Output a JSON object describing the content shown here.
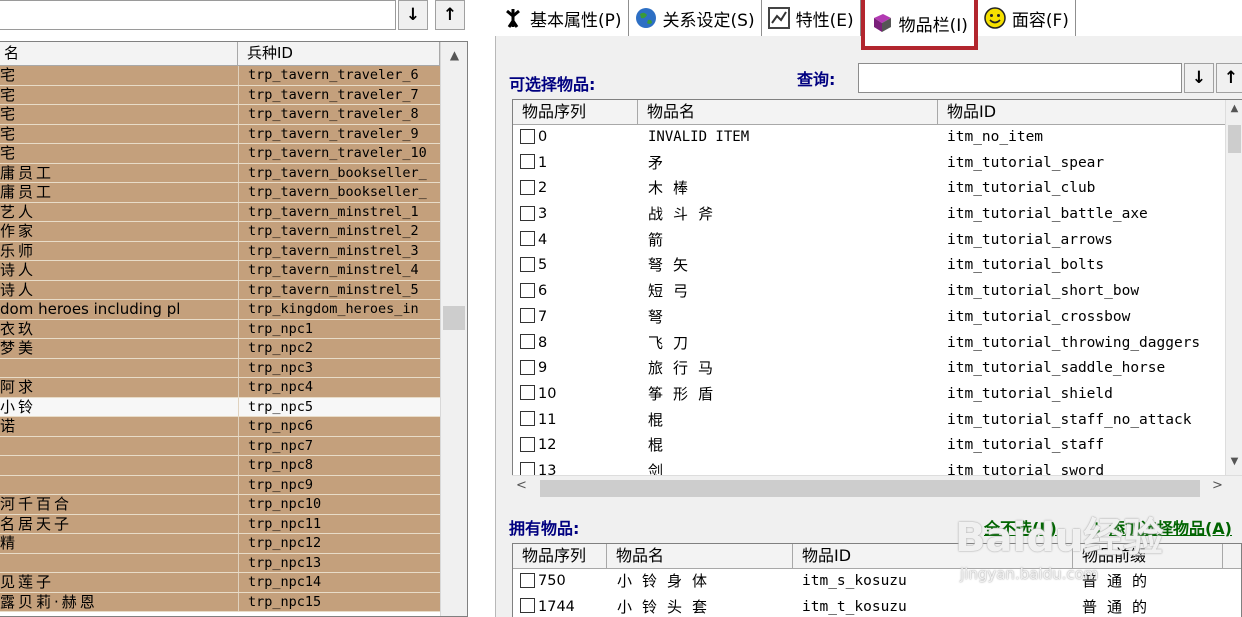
{
  "left_panel": {
    "sort_down_label": "↓",
    "sort_up_label": "↑",
    "columns": [
      "名",
      "兵种ID"
    ],
    "rows": [
      {
        "name": "宅",
        "id": "trp_tavern_traveler_6"
      },
      {
        "name": "宅",
        "id": "trp_tavern_traveler_7"
      },
      {
        "name": "宅",
        "id": "trp_tavern_traveler_8"
      },
      {
        "name": "宅",
        "id": "trp_tavern_traveler_9"
      },
      {
        "name": "宅",
        "id": "trp_tavern_traveler_10"
      },
      {
        "name": "庸员工",
        "id": "trp_tavern_bookseller_"
      },
      {
        "name": "庸员工",
        "id": "trp_tavern_bookseller_"
      },
      {
        "name": "艺人",
        "id": "trp_tavern_minstrel_1"
      },
      {
        "name": "作家",
        "id": "trp_tavern_minstrel_2"
      },
      {
        "name": "乐师",
        "id": "trp_tavern_minstrel_3"
      },
      {
        "name": "诗人",
        "id": "trp_tavern_minstrel_4"
      },
      {
        "name": "诗人",
        "id": "trp_tavern_minstrel_5"
      },
      {
        "name": "dom heroes including pl",
        "id": "trp_kingdom_heroes_in"
      },
      {
        "name": "衣玖",
        "id": "trp_npc1"
      },
      {
        "name": "梦美",
        "id": "trp_npc2"
      },
      {
        "name": "",
        "id": "trp_npc3"
      },
      {
        "name": "阿求",
        "id": "trp_npc4"
      },
      {
        "name": "小铃",
        "id": "trp_npc5"
      },
      {
        "name": "诺",
        "id": "trp_npc6"
      },
      {
        "name": "",
        "id": "trp_npc7"
      },
      {
        "name": "",
        "id": "trp_npc8"
      },
      {
        "name": "",
        "id": "trp_npc9"
      },
      {
        "name": "河千百合",
        "id": "trp_npc10"
      },
      {
        "name": "名居天子",
        "id": "trp_npc11"
      },
      {
        "name": "精",
        "id": "trp_npc12"
      },
      {
        "name": "",
        "id": "trp_npc13"
      },
      {
        "name": "见莲子",
        "id": "trp_npc14"
      },
      {
        "name": "露贝莉·赫恩",
        "id": "trp_npc15"
      }
    ],
    "selected_index": 17
  },
  "tabs": [
    {
      "label": "基本属性(P)",
      "icon": "person-icon"
    },
    {
      "label": "关系设定(S)",
      "icon": "globe-icon"
    },
    {
      "label": "特性(E)",
      "icon": "chart-icon"
    },
    {
      "label": "物品栏(I)",
      "icon": "book-icon"
    },
    {
      "label": "面容(F)",
      "icon": "smiley-icon"
    }
  ],
  "active_tab": 3,
  "available": {
    "title": "可选择物品:",
    "query_label": "查询:",
    "query_value": "",
    "sort_down_label": "↓",
    "sort_up_label": "↑",
    "columns": [
      "物品序列",
      "物品名",
      "物品ID"
    ],
    "rows": [
      {
        "num": "0",
        "name": "INVALID ITEM",
        "id": "itm_no_item"
      },
      {
        "num": "1",
        "name": "矛",
        "id": "itm_tutorial_spear"
      },
      {
        "num": "2",
        "name": "木棒",
        "id": "itm_tutorial_club"
      },
      {
        "num": "3",
        "name": "战斗斧",
        "id": "itm_tutorial_battle_axe"
      },
      {
        "num": "4",
        "name": "箭",
        "id": "itm_tutorial_arrows"
      },
      {
        "num": "5",
        "name": "弩矢",
        "id": "itm_tutorial_bolts"
      },
      {
        "num": "6",
        "name": "短弓",
        "id": "itm_tutorial_short_bow"
      },
      {
        "num": "7",
        "name": "弩",
        "id": "itm_tutorial_crossbow"
      },
      {
        "num": "8",
        "name": "飞刀",
        "id": "itm_tutorial_throwing_daggers"
      },
      {
        "num": "9",
        "name": "旅行马",
        "id": "itm_tutorial_saddle_horse"
      },
      {
        "num": "10",
        "name": "筝形盾",
        "id": "itm_tutorial_shield"
      },
      {
        "num": "11",
        "name": "棍",
        "id": "itm_tutorial_staff_no_attack"
      },
      {
        "num": "12",
        "name": "棍",
        "id": "itm_tutorial_staff"
      },
      {
        "num": "13",
        "name": "剑",
        "id": "itm_tutorial_sword"
      }
    ]
  },
  "owned": {
    "title": "拥有物品:",
    "deselect_all": "全不选(L)",
    "add_selected": "添加选择物品(A)",
    "columns": [
      "物品序列",
      "物品名",
      "物品ID",
      "物品前缀"
    ],
    "rows": [
      {
        "num": "750",
        "name": "小铃身体",
        "id": "itm_s_kosuzu",
        "prefix": "普通的"
      },
      {
        "num": "1744",
        "name": "小铃头套",
        "id": "itm_t_kosuzu",
        "prefix": "普通的"
      }
    ]
  },
  "watermark": {
    "text": "Baidu经验",
    "sub": "jingyan.baidu.com"
  }
}
